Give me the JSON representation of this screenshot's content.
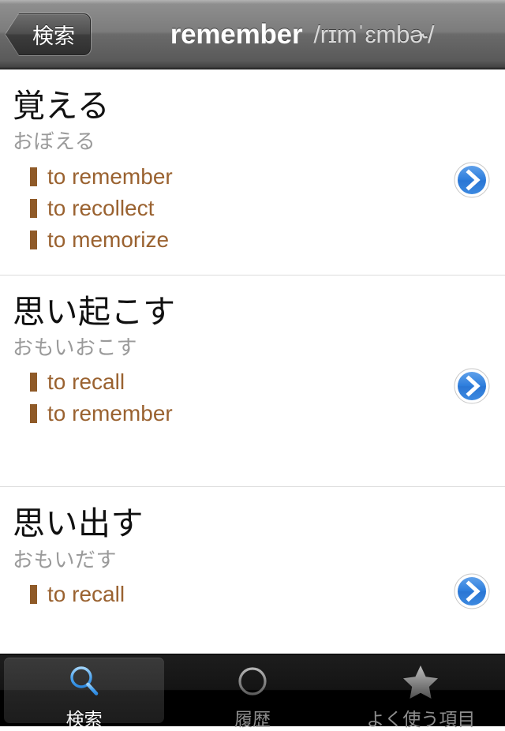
{
  "navbar": {
    "back_button_label": "検索",
    "headword": "remember",
    "ipa": "/rɪmˈɛmbɚ/"
  },
  "entries": [
    {
      "word": "覚える",
      "reading": "おぼえる",
      "glosses": [
        "to remember",
        "to recollect",
        "to memorize"
      ],
      "disclosure_icon": "chevron-right-circle-icon"
    },
    {
      "word": "思い起こす",
      "reading": "おもいおこす",
      "glosses": [
        "to recall",
        "to remember"
      ],
      "disclosure_icon": "chevron-right-circle-icon"
    },
    {
      "word": "思い出す",
      "reading": "おもいだす",
      "glosses": [
        "to recall"
      ],
      "disclosure_icon": "chevron-right-circle-icon"
    }
  ],
  "tabbar": {
    "tabs": [
      {
        "label": "検索",
        "icon": "search-icon",
        "active": true
      },
      {
        "label": "履歴",
        "icon": "clock-icon",
        "active": false
      },
      {
        "label": "よく使う項目",
        "icon": "star-icon",
        "active": false
      }
    ]
  },
  "colors": {
    "gloss_text": "#9a6230",
    "bullet": "#8f5a28",
    "reading_text": "#9a9a9a",
    "word_text": "#111111",
    "disclosure_blue": "#2f7fdd",
    "active_tab_icon": "#4aa3f0",
    "separator": "#dcdcdc"
  }
}
